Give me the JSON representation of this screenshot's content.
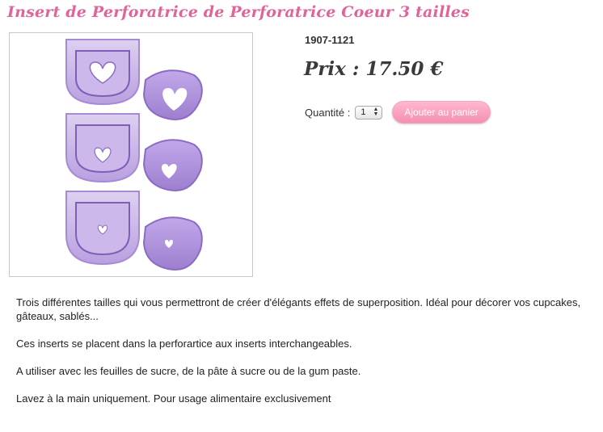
{
  "product": {
    "title": "Insert de Perforatrice de Perforatrice Coeur 3 tailles",
    "reference": "1907-1121",
    "price_label": "Prix : 17.50 €"
  },
  "purchase": {
    "quantity_label": "Quantité :",
    "quantity_value": "1",
    "add_to_cart_label": "Ajouter au panier"
  },
  "description": {
    "paragraphs": [
      "Trois différentes tailles qui vous permettront de créer d'élégants effets de superposition. Idéal pour décorer vos cupcakes, gâteaux, sablés...",
      "Ces inserts se placent dans la perforartice aux inserts interchangeables.",
      "A utiliser avec les feuilles de sucre, de la pâte à sucre ou de la gum paste.",
      "Lavez à la main uniquement. Pour usage alimentaire exclusivement"
    ]
  },
  "colors": {
    "title": "#e0639a",
    "button": "#f58fb2",
    "insert_light": "#c9b4e6",
    "insert_dark": "#9a7cc9"
  },
  "image": {
    "icon": "heart-punch-inserts-photo"
  }
}
